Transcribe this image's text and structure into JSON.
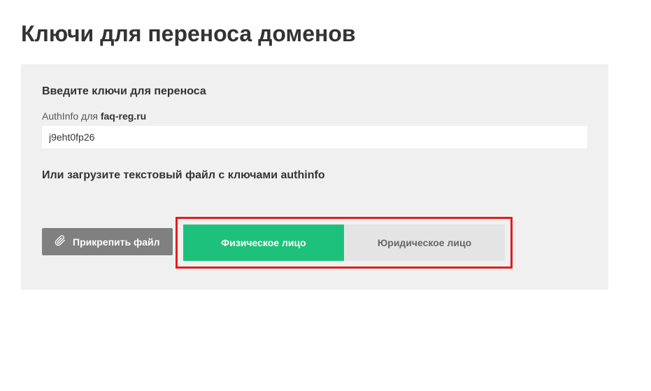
{
  "page": {
    "title": "Ключи для переноса доменов"
  },
  "form": {
    "enter_keys_heading": "Введите ключи для переноса",
    "authinfo_label_prefix": "AuthInfo для ",
    "authinfo_domain": "faq-reg.ru",
    "authinfo_value": "j9eht0fp26",
    "or_upload_heading": "Или загрузите текстовый файл с ключами authinfo",
    "attach_button_label": "Прикрепить файл"
  },
  "entity_type": {
    "individual_label": "Физическое лицо",
    "legal_label": "Юридическое лицо",
    "selected": "individual"
  },
  "colors": {
    "panel_bg": "#f0f0f0",
    "accent_green": "#1ec17b",
    "highlight_border": "#e51c1c",
    "gray_button": "#808080"
  }
}
